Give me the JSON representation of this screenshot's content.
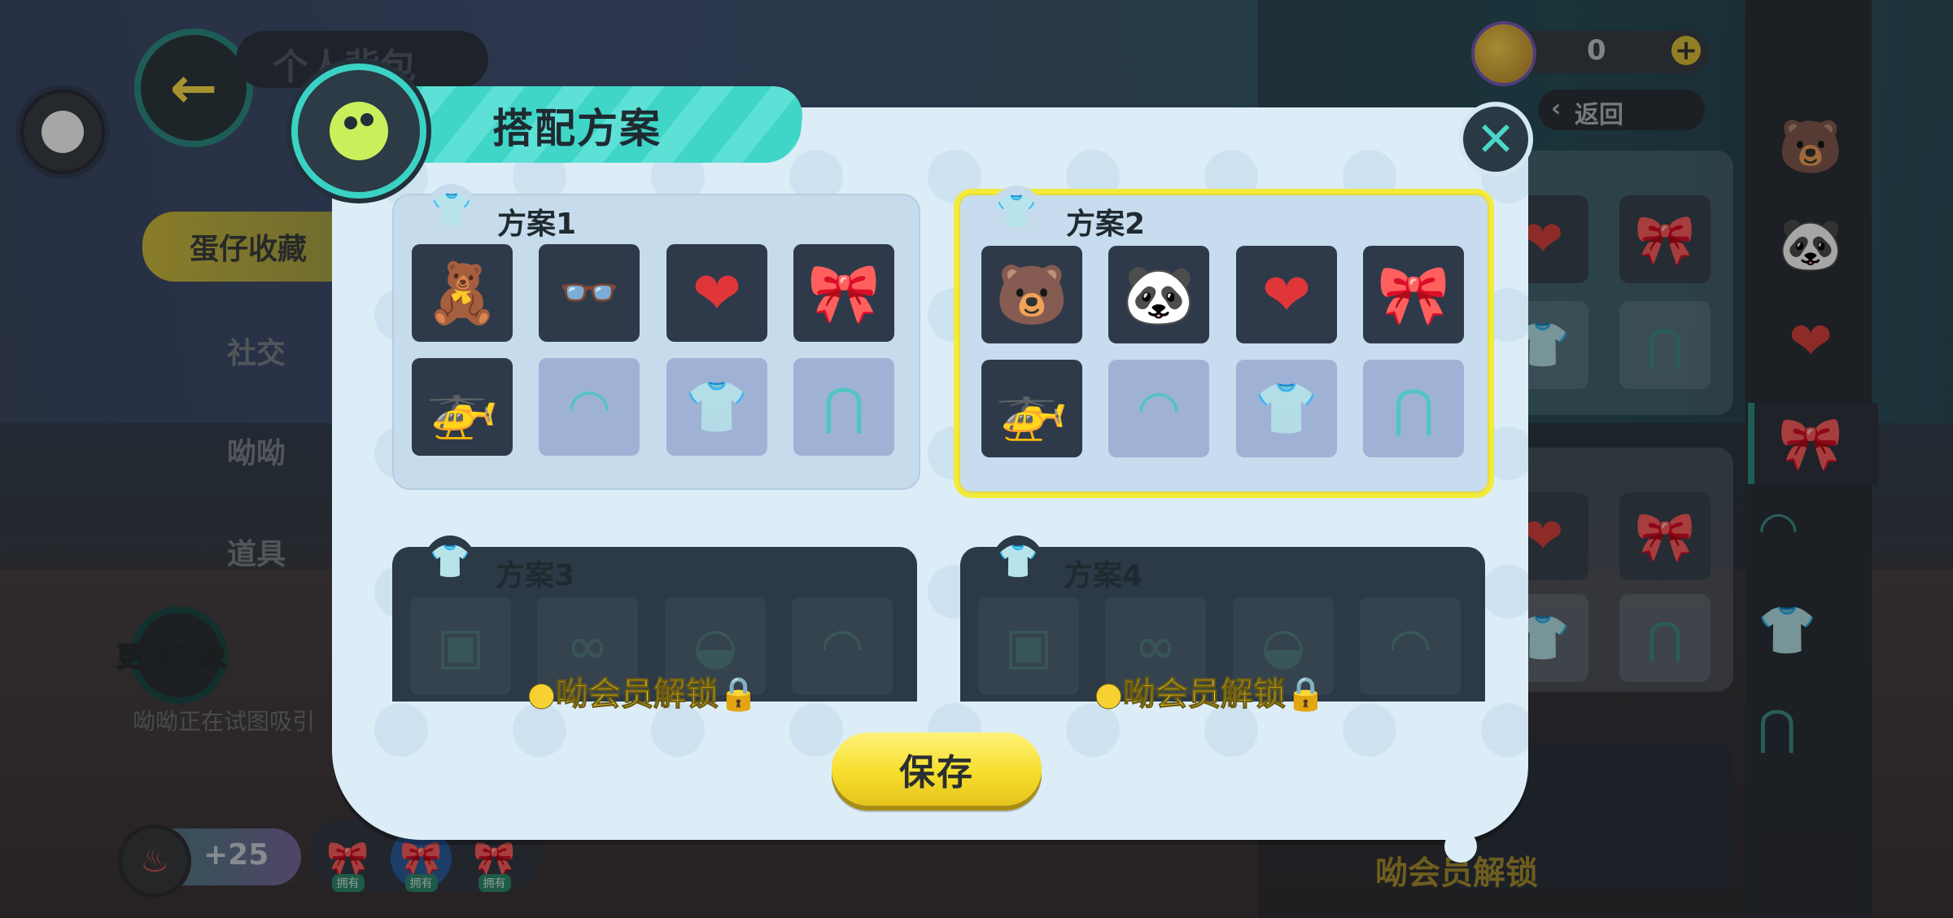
{
  "background": {
    "back_title": "个人背包",
    "tabs": [
      "社交",
      "呦呦",
      "道具"
    ],
    "active_tab": "蛋仔收藏",
    "avatar_button": "更换形象",
    "hint": "呦呦正在试图吸引",
    "score": "+25",
    "owned_tag": "拥有",
    "coins": "0",
    "return_label": "返回",
    "right_lock_label": "呦会员解锁"
  },
  "dialog": {
    "title": "搭配方案",
    "save_label": "保存",
    "lock_label": "呦会员解锁",
    "plans": [
      {
        "name": "方案1",
        "selected": false,
        "locked": false,
        "slots": [
          "bear-costume",
          "glasses",
          "hearts",
          "butterfly-bow",
          "propeller-backpack",
          "empty-hat",
          "empty-top",
          "empty-pants"
        ]
      },
      {
        "name": "方案2",
        "selected": true,
        "locked": false,
        "slots": [
          "pink-bear-costume",
          "panda-face",
          "hearts",
          "butterfly-bow",
          "propeller-backpack",
          "empty-hat",
          "empty-top",
          "empty-pants"
        ]
      },
      {
        "name": "方案3",
        "selected": false,
        "locked": true
      },
      {
        "name": "方案4",
        "selected": false,
        "locked": true
      }
    ]
  },
  "colors": {
    "accent_teal": "#3ad2c4",
    "select_yellow": "#f4ea3a",
    "save_yellow": "#f6de2c",
    "lock_gold": "#f6d131"
  }
}
